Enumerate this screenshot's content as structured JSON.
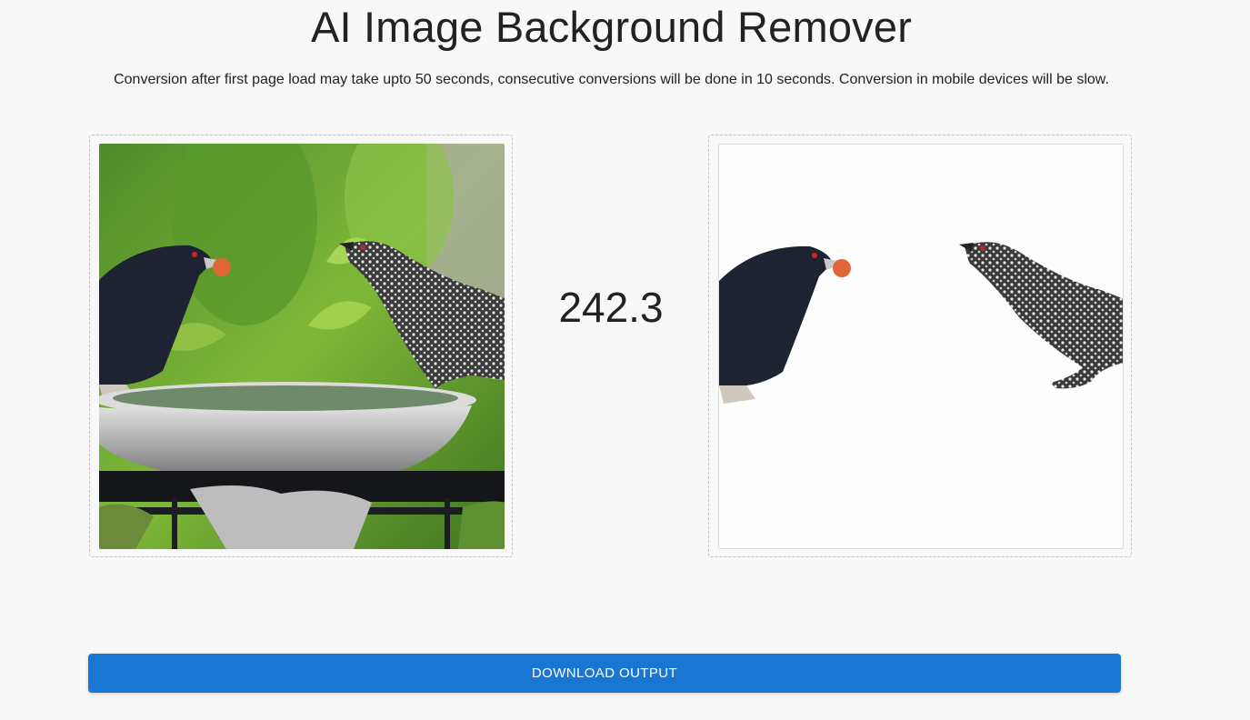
{
  "header": {
    "title": "AI Image Background Remover",
    "subtitle": "Conversion after first page load may take upto 50 seconds, consecutive conversions will be done in 10 seconds. Conversion in mobile devices will be slow."
  },
  "input_panel": {
    "image_description_icon": "input-photo-birds-on-birdbath"
  },
  "output_panel": {
    "image_description_icon": "output-photo-birds-background-removed"
  },
  "timer": {
    "value": "242.3"
  },
  "actions": {
    "download_label": "DOWNLOAD OUTPUT"
  },
  "colors": {
    "accent": "#1976d2",
    "background": "#f8f8f8",
    "text": "#222222"
  }
}
